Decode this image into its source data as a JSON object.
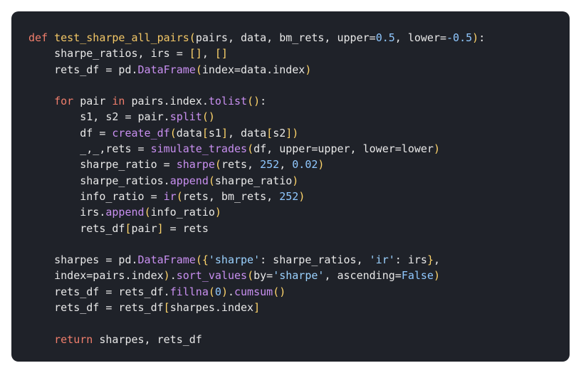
{
  "code": {
    "lines": [
      [
        [
          "kw",
          "def "
        ],
        [
          "fn",
          "test_sharpe_all_pairs"
        ],
        [
          "br",
          "("
        ],
        [
          "tx",
          "pairs, data, bm_rets, upper="
        ],
        [
          "num",
          "0.5"
        ],
        [
          "tx",
          ", lower="
        ],
        [
          "num",
          "-0.5"
        ],
        [
          "br",
          ")"
        ],
        [
          "tx",
          ":"
        ]
      ],
      [
        [
          "tx",
          "    sharpe_ratios, irs = "
        ],
        [
          "br",
          "[]"
        ],
        [
          "tx",
          ", "
        ],
        [
          "br",
          "[]"
        ]
      ],
      [
        [
          "tx",
          "    rets_df = pd."
        ],
        [
          "call",
          "DataFrame"
        ],
        [
          "br",
          "("
        ],
        [
          "tx",
          "index=data.index"
        ],
        [
          "br",
          ")"
        ]
      ],
      [],
      [
        [
          "tx",
          "    "
        ],
        [
          "kw",
          "for"
        ],
        [
          "tx",
          " pair "
        ],
        [
          "kw",
          "in"
        ],
        [
          "tx",
          " pairs.index."
        ],
        [
          "call",
          "tolist"
        ],
        [
          "br",
          "()"
        ],
        [
          "tx",
          ":"
        ]
      ],
      [
        [
          "tx",
          "        s1, s2 = pair."
        ],
        [
          "call",
          "split"
        ],
        [
          "br",
          "()"
        ]
      ],
      [
        [
          "tx",
          "        df = "
        ],
        [
          "call",
          "create_df"
        ],
        [
          "br",
          "("
        ],
        [
          "tx",
          "data"
        ],
        [
          "br",
          "["
        ],
        [
          "tx",
          "s1"
        ],
        [
          "br",
          "]"
        ],
        [
          "tx",
          ", data"
        ],
        [
          "br",
          "["
        ],
        [
          "tx",
          "s2"
        ],
        [
          "br",
          "]"
        ],
        [
          "br",
          ")"
        ]
      ],
      [
        [
          "tx",
          "        _,_,rets = "
        ],
        [
          "call",
          "simulate_trades"
        ],
        [
          "br",
          "("
        ],
        [
          "tx",
          "df, upper=upper, lower=lower"
        ],
        [
          "br",
          ")"
        ]
      ],
      [
        [
          "tx",
          "        sharpe_ratio = "
        ],
        [
          "call",
          "sharpe"
        ],
        [
          "br",
          "("
        ],
        [
          "tx",
          "rets, "
        ],
        [
          "num",
          "252"
        ],
        [
          "tx",
          ", "
        ],
        [
          "num",
          "0.02"
        ],
        [
          "br",
          ")"
        ]
      ],
      [
        [
          "tx",
          "        sharpe_ratios."
        ],
        [
          "call",
          "append"
        ],
        [
          "br",
          "("
        ],
        [
          "tx",
          "sharpe_ratio"
        ],
        [
          "br",
          ")"
        ]
      ],
      [
        [
          "tx",
          "        info_ratio = "
        ],
        [
          "call",
          "ir"
        ],
        [
          "br",
          "("
        ],
        [
          "tx",
          "rets, bm_rets, "
        ],
        [
          "num",
          "252"
        ],
        [
          "br",
          ")"
        ]
      ],
      [
        [
          "tx",
          "        irs."
        ],
        [
          "call",
          "append"
        ],
        [
          "br",
          "("
        ],
        [
          "tx",
          "info_ratio"
        ],
        [
          "br",
          ")"
        ]
      ],
      [
        [
          "tx",
          "        rets_df"
        ],
        [
          "br",
          "["
        ],
        [
          "tx",
          "pair"
        ],
        [
          "br",
          "]"
        ],
        [
          "tx",
          " = rets"
        ]
      ],
      [],
      [
        [
          "tx",
          "    sharpes = pd."
        ],
        [
          "call",
          "DataFrame"
        ],
        [
          "br",
          "({"
        ],
        [
          "str",
          "'sharpe'"
        ],
        [
          "tx",
          ": sharpe_ratios, "
        ],
        [
          "str",
          "'ir'"
        ],
        [
          "tx",
          ": irs"
        ],
        [
          "br",
          "}"
        ],
        [
          "tx",
          ","
        ]
      ],
      [
        [
          "tx",
          "    index=pairs.index"
        ],
        [
          "br",
          ")"
        ],
        [
          "tx",
          "."
        ],
        [
          "call",
          "sort_values"
        ],
        [
          "br",
          "("
        ],
        [
          "tx",
          "by="
        ],
        [
          "str",
          "'sharpe'"
        ],
        [
          "tx",
          ", ascending="
        ],
        [
          "num",
          "False"
        ],
        [
          "br",
          ")"
        ]
      ],
      [
        [
          "tx",
          "    rets_df = rets_df."
        ],
        [
          "call",
          "fillna"
        ],
        [
          "br",
          "("
        ],
        [
          "num",
          "0"
        ],
        [
          "br",
          ")"
        ],
        [
          "tx",
          "."
        ],
        [
          "call",
          "cumsum"
        ],
        [
          "br",
          "()"
        ]
      ],
      [
        [
          "tx",
          "    rets_df = rets_df"
        ],
        [
          "br",
          "["
        ],
        [
          "tx",
          "sharpes.index"
        ],
        [
          "br",
          "]"
        ]
      ],
      [],
      [
        [
          "tx",
          "    "
        ],
        [
          "kw",
          "return"
        ],
        [
          "tx",
          " sharpes, rets_df"
        ]
      ]
    ]
  },
  "colors": {
    "background": "#1f2229",
    "keyword": "#f07e6c",
    "function": "#f3c766",
    "call": "#c88ff0",
    "number": "#90c8ff",
    "string": "#9bd2ff",
    "bracket": "#ffd56b",
    "text": "#e8e8e8"
  }
}
